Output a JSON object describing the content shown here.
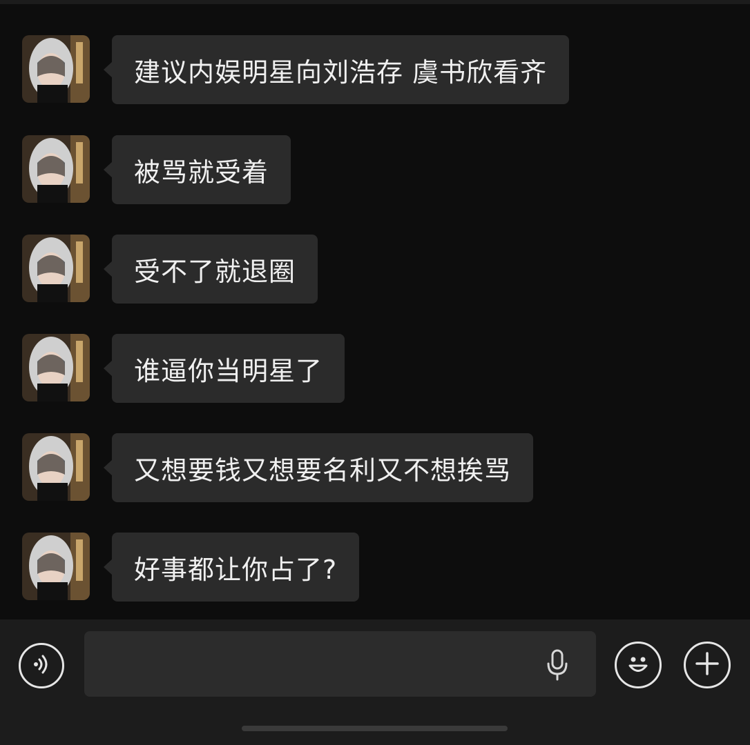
{
  "chat": {
    "messages": [
      {
        "text": "建议内娱明星向刘浩存 虞书欣看齐"
      },
      {
        "text": "被骂就受着"
      },
      {
        "text": "受不了就退圈"
      },
      {
        "text": "谁逼你当明星了"
      },
      {
        "text": "又想要钱又想要名利又不想挨骂"
      },
      {
        "text": "好事都让你占了?"
      }
    ]
  },
  "input_bar": {
    "voice_icon": "voice-toggle-icon",
    "mic_icon": "microphone-icon",
    "emoji_icon": "emoji-smile-icon",
    "plus_icon": "plus-icon",
    "input_value": ""
  },
  "colors": {
    "background": "#0d0d0d",
    "bubble": "#2b2b2b",
    "input_bar": "#1c1c1c",
    "text": "#f0f0f0"
  }
}
